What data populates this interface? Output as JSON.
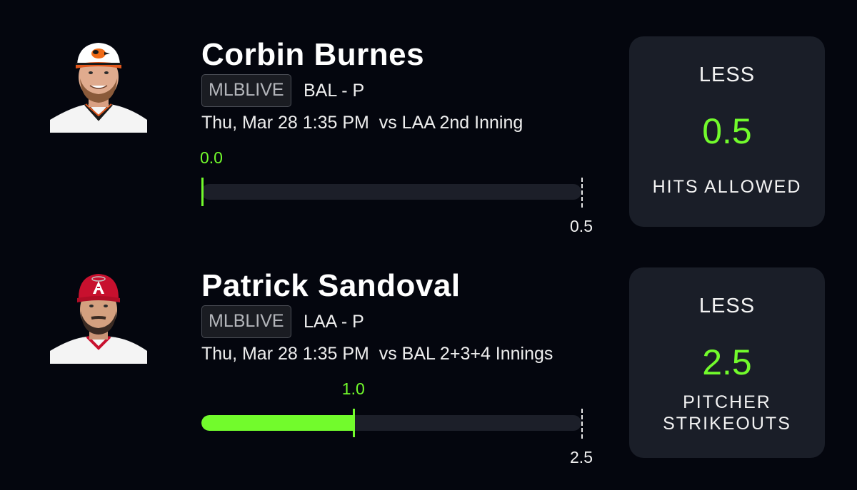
{
  "picks": [
    {
      "player_name": "Corbin Burnes",
      "league_badge": "MLBLIVE",
      "team_position": "BAL - P",
      "game_info": "Thu, Mar 28 1:35 PM  vs LAA 2nd Inning",
      "progress": {
        "current_value": 0.0,
        "current_label": "0.0",
        "target_value": 0.5,
        "target_label": "0.5"
      },
      "line": {
        "direction": "LESS",
        "value": "0.5",
        "stat_lines": [
          "HITS ALLOWED"
        ]
      },
      "avatar": {
        "icon": "player-headshot-icon",
        "cap_color": "#ffffff",
        "cap_brim_color": "#e2571c",
        "logo_color": "#f06a16",
        "jersey_color": "#f4f4f4",
        "jersey_trim_color": "#1a1a1a"
      }
    },
    {
      "player_name": "Patrick Sandoval",
      "league_badge": "MLBLIVE",
      "team_position": "LAA - P",
      "game_info": "Thu, Mar 28 1:35 PM  vs BAL 2+3+4 Innings",
      "progress": {
        "current_value": 1.0,
        "current_label": "1.0",
        "target_value": 2.5,
        "target_label": "2.5"
      },
      "line": {
        "direction": "LESS",
        "value": "2.5",
        "stat_lines": [
          "PITCHER",
          "STRIKEOUTS"
        ]
      },
      "avatar": {
        "icon": "player-headshot-icon",
        "cap_color": "#c8102e",
        "cap_brim_color": "#b00d26",
        "logo_color": "#ffffff",
        "jersey_color": "#f4f4f4",
        "jersey_trim_color": "#c8102e"
      }
    }
  ],
  "colors": {
    "background": "#04060e",
    "card": "#1a1e28",
    "accent_green": "#72fb2c",
    "track": "#1c1f29"
  }
}
